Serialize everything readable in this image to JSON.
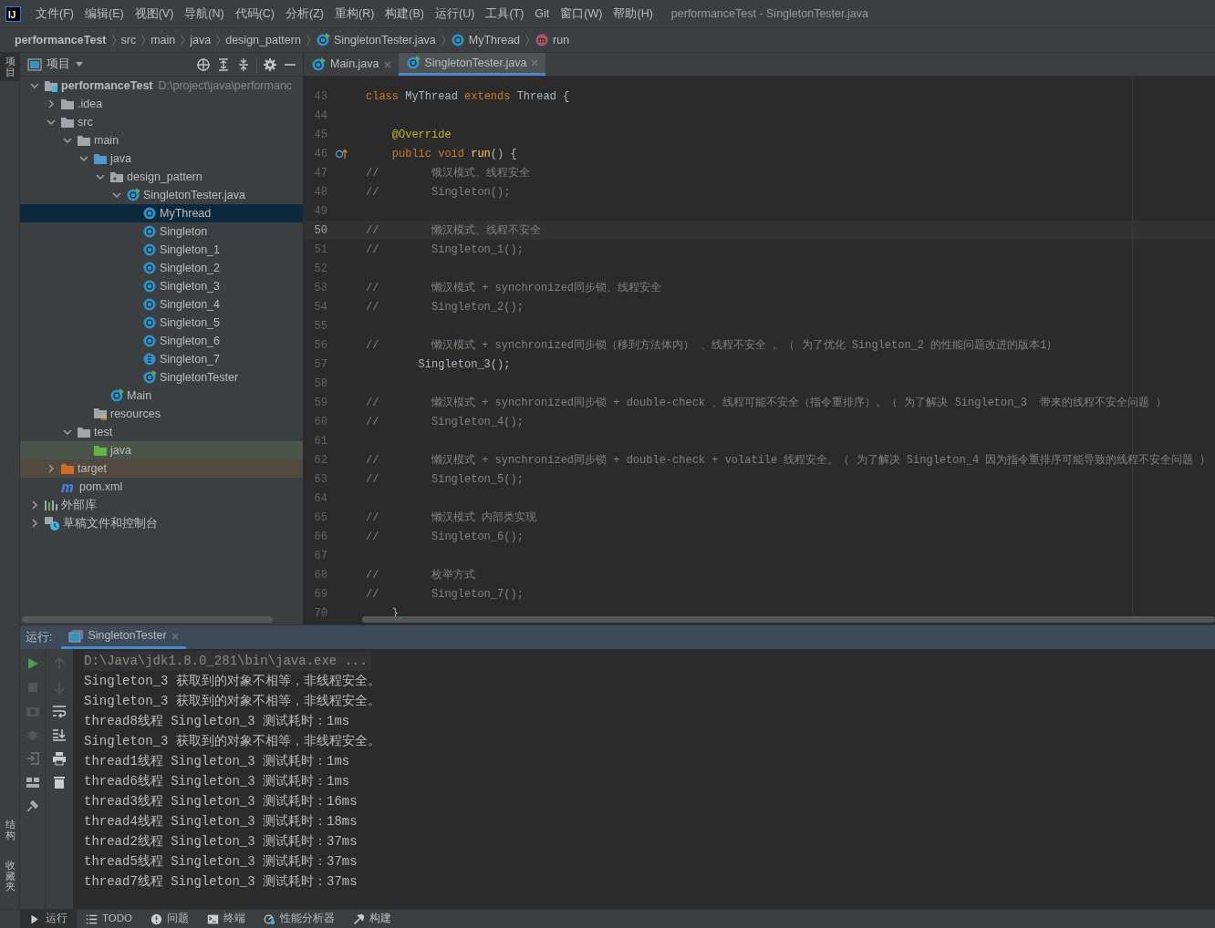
{
  "title_bar": {
    "app_logo": "IJ",
    "menus": [
      "文件(F)",
      "编辑(E)",
      "视图(V)",
      "导航(N)",
      "代码(C)",
      "分析(Z)",
      "重构(R)",
      "构建(B)",
      "运行(U)",
      "工具(T)",
      "Git",
      "窗口(W)",
      "帮助(H)"
    ],
    "title": "performanceTest - SingletonTester.java"
  },
  "breadcrumb": [
    {
      "text": "performanceTest",
      "kind": "project"
    },
    {
      "text": "src",
      "kind": "folder"
    },
    {
      "text": "main",
      "kind": "folder"
    },
    {
      "text": "java",
      "kind": "folder"
    },
    {
      "text": "design_pattern",
      "kind": "folder"
    },
    {
      "text": "SingletonTester.java",
      "kind": "class-file"
    },
    {
      "text": "MyThread",
      "kind": "class"
    },
    {
      "text": "run",
      "kind": "method"
    }
  ],
  "left_strip": [
    {
      "label": "项目",
      "selected": true
    },
    {
      "label": "结构",
      "selected": false
    },
    {
      "label": "收藏夹",
      "selected": false
    }
  ],
  "project_panel": {
    "title": "项目",
    "tree": [
      {
        "label": "performanceTest",
        "path": "D:\\project\\java\\performanc",
        "kind": "module",
        "expanded": true,
        "selected": false,
        "children": [
          {
            "label": ".idea",
            "kind": "folder",
            "expanded": false,
            "selected": false
          },
          {
            "label": "src",
            "kind": "folder",
            "expanded": true,
            "selected": false,
            "children": [
              {
                "label": "main",
                "kind": "folder",
                "expanded": true,
                "selected": false,
                "children": [
                  {
                    "label": "java",
                    "kind": "source-folder",
                    "expanded": true,
                    "selected": false,
                    "children": [
                      {
                        "label": "design_pattern",
                        "kind": "package",
                        "expanded": true,
                        "selected": false,
                        "children": [
                          {
                            "label": "SingletonTester.java",
                            "kind": "main-class",
                            "expanded": true,
                            "selected": false,
                            "children": [
                              {
                                "label": "MyThread",
                                "kind": "class",
                                "selected": true
                              },
                              {
                                "label": "Singleton",
                                "kind": "class",
                                "selected": false
                              },
                              {
                                "label": "Singleton_1",
                                "kind": "class",
                                "selected": false
                              },
                              {
                                "label": "Singleton_2",
                                "kind": "class",
                                "selected": false
                              },
                              {
                                "label": "Singleton_3",
                                "kind": "class",
                                "selected": false
                              },
                              {
                                "label": "Singleton_4",
                                "kind": "class",
                                "selected": false
                              },
                              {
                                "label": "Singleton_5",
                                "kind": "class",
                                "selected": false
                              },
                              {
                                "label": "Singleton_6",
                                "kind": "class",
                                "selected": false
                              },
                              {
                                "label": "Singleton_7",
                                "kind": "enum",
                                "selected": false
                              },
                              {
                                "label": "SingletonTester",
                                "kind": "main-class",
                                "selected": false
                              }
                            ]
                          }
                        ]
                      },
                      {
                        "label": "Main",
                        "kind": "main-class",
                        "selected": false
                      }
                    ]
                  },
                  {
                    "label": "resources",
                    "kind": "resources-folder",
                    "selected": false
                  }
                ]
              },
              {
                "label": "test",
                "kind": "folder",
                "expanded": true,
                "selected": false,
                "children": [
                  {
                    "label": "java",
                    "kind": "test-folder",
                    "selected": false
                  }
                ]
              }
            ]
          },
          {
            "label": "target",
            "kind": "excluded-folder",
            "expanded": false,
            "selected": false
          },
          {
            "label": "pom.xml",
            "kind": "maven",
            "selected": false
          }
        ]
      },
      {
        "label": "外部库",
        "kind": "libraries",
        "expanded": false,
        "selected": false
      },
      {
        "label": "草稿文件和控制台",
        "kind": "scratches",
        "expanded": false,
        "selected": false
      }
    ]
  },
  "editor_tabs": [
    {
      "label": "Main.java",
      "selected": false
    },
    {
      "label": "SingletonTester.java",
      "selected": true
    }
  ],
  "code_lines": [
    {
      "number": "43",
      "current": false,
      "override": false,
      "tokens": [
        {
          "kind": "kw",
          "text": "class "
        },
        {
          "kind": "plain",
          "text": "MyThread "
        },
        {
          "kind": "kw",
          "text": "extends "
        },
        {
          "kind": "plain",
          "text": "Thread {"
        }
      ]
    },
    {
      "number": "44",
      "current": false,
      "override": false
    },
    {
      "number": "45",
      "current": false,
      "override": false,
      "tokens": [
        {
          "kind": "ann",
          "text": "    @Override"
        }
      ]
    },
    {
      "number": "46",
      "current": false,
      "override": true,
      "tokens": [
        {
          "kind": "kw",
          "text": "    public void "
        },
        {
          "kind": "method",
          "text": "run"
        },
        {
          "kind": "plain",
          "text": "() {"
        }
      ]
    },
    {
      "number": "47",
      "current": false,
      "override": false,
      "tokens": [
        {
          "kind": "comment",
          "text": "//        饿汉模式、线程安全"
        }
      ]
    },
    {
      "number": "48",
      "current": false,
      "override": false,
      "tokens": [
        {
          "kind": "comment",
          "text": "//        Singleton();"
        }
      ]
    },
    {
      "number": "49",
      "current": false,
      "override": false
    },
    {
      "number": "50",
      "current": true,
      "override": false,
      "tokens": [
        {
          "kind": "comment",
          "text": "//        懒汉模式、线程不安全"
        }
      ]
    },
    {
      "number": "51",
      "current": false,
      "override": false,
      "tokens": [
        {
          "kind": "comment",
          "text": "//        Singleton_1();"
        }
      ]
    },
    {
      "number": "52",
      "current": false,
      "override": false
    },
    {
      "number": "53",
      "current": false,
      "override": false,
      "tokens": [
        {
          "kind": "comment",
          "text": "//        懒汉模式 + synchronized同步锁、线程安全"
        }
      ]
    },
    {
      "number": "54",
      "current": false,
      "override": false,
      "tokens": [
        {
          "kind": "comment",
          "text": "//        Singleton_2();"
        }
      ]
    },
    {
      "number": "55",
      "current": false,
      "override": false
    },
    {
      "number": "56",
      "current": false,
      "override": false,
      "tokens": [
        {
          "kind": "comment",
          "text": "//        懒汉模式 + synchronized同步锁（移到方法体内） 、线程不安全 。（ 为了优化 Singleton_2 的性能问题改进的版本1）"
        }
      ]
    },
    {
      "number": "57",
      "current": false,
      "override": false,
      "tokens": [
        {
          "kind": "plain",
          "text": "        Singleton_3();"
        }
      ]
    },
    {
      "number": "58",
      "current": false,
      "override": false
    },
    {
      "number": "59",
      "current": false,
      "override": false,
      "tokens": [
        {
          "kind": "comment",
          "text": "//        懒汉模式 + synchronized同步锁 + double-check 、线程可能不安全（指令重排序）。（ 为了解决 Singleton_3  带来的线程不安全问题 ）"
        }
      ]
    },
    {
      "number": "60",
      "current": false,
      "override": false,
      "tokens": [
        {
          "kind": "comment",
          "text": "//        Singleton_4();"
        }
      ]
    },
    {
      "number": "61",
      "current": false,
      "override": false
    },
    {
      "number": "62",
      "current": false,
      "override": false,
      "tokens": [
        {
          "kind": "comment",
          "text": "//        懒汉模式 + synchronized同步锁 + double-check + volatile 线程安全。（ 为了解决 Singleton_4 因为指令重排序可能导致的线程不安全问题 ）"
        }
      ]
    },
    {
      "number": "63",
      "current": false,
      "override": false,
      "tokens": [
        {
          "kind": "comment",
          "text": "//        Singleton_5();"
        }
      ]
    },
    {
      "number": "64",
      "current": false,
      "override": false
    },
    {
      "number": "65",
      "current": false,
      "override": false,
      "tokens": [
        {
          "kind": "comment",
          "text": "//        懒汉模式 内部类实现"
        }
      ]
    },
    {
      "number": "66",
      "current": false,
      "override": false,
      "tokens": [
        {
          "kind": "comment",
          "text": "//        Singleton_6();"
        }
      ]
    },
    {
      "number": "67",
      "current": false,
      "override": false
    },
    {
      "number": "68",
      "current": false,
      "override": false,
      "tokens": [
        {
          "kind": "comment",
          "text": "//        枚举方式"
        }
      ]
    },
    {
      "number": "69",
      "current": false,
      "override": false,
      "tokens": [
        {
          "kind": "comment",
          "text": "//        Singleton_7();"
        }
      ]
    },
    {
      "number": "70",
      "current": false,
      "override": false,
      "tokens": [
        {
          "kind": "plain",
          "text": "    }"
        }
      ]
    }
  ],
  "run_panel": {
    "label": "运行:",
    "tabs": [
      {
        "label": "SingletonTester",
        "selected": true
      }
    ],
    "console": [
      {
        "kind": "command",
        "text": "D:\\Java\\jdk1.8.0_281\\bin\\java.exe ..."
      },
      {
        "kind": "output",
        "text": "Singleton_3 获取到的对象不相等，非线程安全。"
      },
      {
        "kind": "output",
        "text": "Singleton_3 获取到的对象不相等，非线程安全。"
      },
      {
        "kind": "output",
        "text": "thread8线程 Singleton_3 测试耗时：1ms"
      },
      {
        "kind": "output",
        "text": "Singleton_3 获取到的对象不相等，非线程安全。"
      },
      {
        "kind": "output",
        "text": "thread1线程 Singleton_3 测试耗时：1ms"
      },
      {
        "kind": "output",
        "text": "thread6线程 Singleton_3 测试耗时：1ms"
      },
      {
        "kind": "output",
        "text": "thread3线程 Singleton_3 测试耗时：16ms"
      },
      {
        "kind": "output",
        "text": "thread4线程 Singleton_3 测试耗时：18ms"
      },
      {
        "kind": "output",
        "text": "thread2线程 Singleton_3 测试耗时：37ms"
      },
      {
        "kind": "output",
        "text": "thread5线程 Singleton_3 测试耗时：37ms"
      },
      {
        "kind": "output",
        "text": "thread7线程 Singleton_3 测试耗时：37ms"
      }
    ]
  },
  "bottom_tabs": [
    {
      "label": "运行",
      "kind": "run",
      "selected": true
    },
    {
      "label": "TODO",
      "kind": "todo",
      "selected": false
    },
    {
      "label": "问题",
      "kind": "problems",
      "selected": false
    },
    {
      "label": "终端",
      "kind": "terminal",
      "selected": false
    },
    {
      "label": "性能分析器",
      "kind": "profiler",
      "selected": false
    },
    {
      "label": "构建",
      "kind": "build",
      "selected": false
    }
  ]
}
